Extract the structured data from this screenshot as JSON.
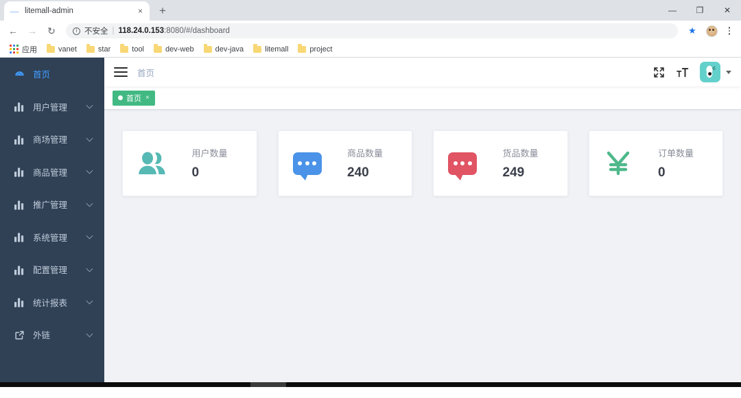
{
  "browser": {
    "tab": {
      "title": "litemall-admin",
      "favicon": "dash-favicon",
      "close_label": "×"
    },
    "new_tab_label": "+",
    "window_controls": [
      {
        "name": "minimize-button",
        "glyph": "—"
      },
      {
        "name": "maximize-button",
        "glyph": "❐"
      },
      {
        "name": "close-button",
        "glyph": "✕"
      }
    ],
    "nav": {
      "back_glyph": "←",
      "forward_glyph": "→",
      "reload_glyph": "↻"
    },
    "omnibox": {
      "security_label": "不安全",
      "separator": "|",
      "url_host": "118.24.0.153",
      "url_rest": ":8080/#/dashboard",
      "star_glyph": "★"
    },
    "bookmarks": [
      {
        "label": "应用",
        "icon": "apps-grid-icon"
      },
      {
        "label": "vanet",
        "icon": "folder-icon"
      },
      {
        "label": "star",
        "icon": "folder-icon"
      },
      {
        "label": "tool",
        "icon": "folder-icon"
      },
      {
        "label": "dev-web",
        "icon": "folder-icon"
      },
      {
        "label": "dev-java",
        "icon": "folder-icon"
      },
      {
        "label": "litemall",
        "icon": "folder-icon"
      },
      {
        "label": "project",
        "icon": "folder-icon"
      }
    ]
  },
  "sidebar": {
    "bg_color": "#304156",
    "active_color": "#409eff",
    "items": [
      {
        "label": "首页",
        "icon": "dashboard-icon",
        "active": true,
        "expandable": false
      },
      {
        "label": "用户管理",
        "icon": "chart-bar-icon",
        "active": false,
        "expandable": true
      },
      {
        "label": "商场管理",
        "icon": "chart-bar-icon",
        "active": false,
        "expandable": true
      },
      {
        "label": "商品管理",
        "icon": "chart-bar-icon",
        "active": false,
        "expandable": true
      },
      {
        "label": "推广管理",
        "icon": "chart-bar-icon",
        "active": false,
        "expandable": true
      },
      {
        "label": "系统管理",
        "icon": "chart-bar-icon",
        "active": false,
        "expandable": true
      },
      {
        "label": "配置管理",
        "icon": "chart-bar-icon",
        "active": false,
        "expandable": true
      },
      {
        "label": "统计报表",
        "icon": "chart-bar-icon",
        "active": false,
        "expandable": true
      },
      {
        "label": "外链",
        "icon": "external-link-icon",
        "active": false,
        "expandable": true
      }
    ]
  },
  "navbar": {
    "breadcrumb": "首页",
    "hamburger_name": "hamburger-icon",
    "fullscreen_name": "fullscreen-icon",
    "fontsize_name": "font-size-icon",
    "avatar_color": "#63d0cb"
  },
  "tagsview": {
    "tags": [
      {
        "label": "首页",
        "active": true,
        "close_glyph": "×"
      }
    ]
  },
  "dashboard": {
    "cards": [
      {
        "title": "用户数量",
        "value": "0",
        "icon": "users-icon",
        "color": "#57b9b4"
      },
      {
        "title": "商品数量",
        "value": "240",
        "icon": "message-icon",
        "color": "#4a93e8"
      },
      {
        "title": "货品数量",
        "value": "249",
        "icon": "message-icon",
        "color": "#e05464"
      },
      {
        "title": "订单数量",
        "value": "0",
        "icon": "yen-icon",
        "color": "#4eb88a"
      }
    ]
  }
}
